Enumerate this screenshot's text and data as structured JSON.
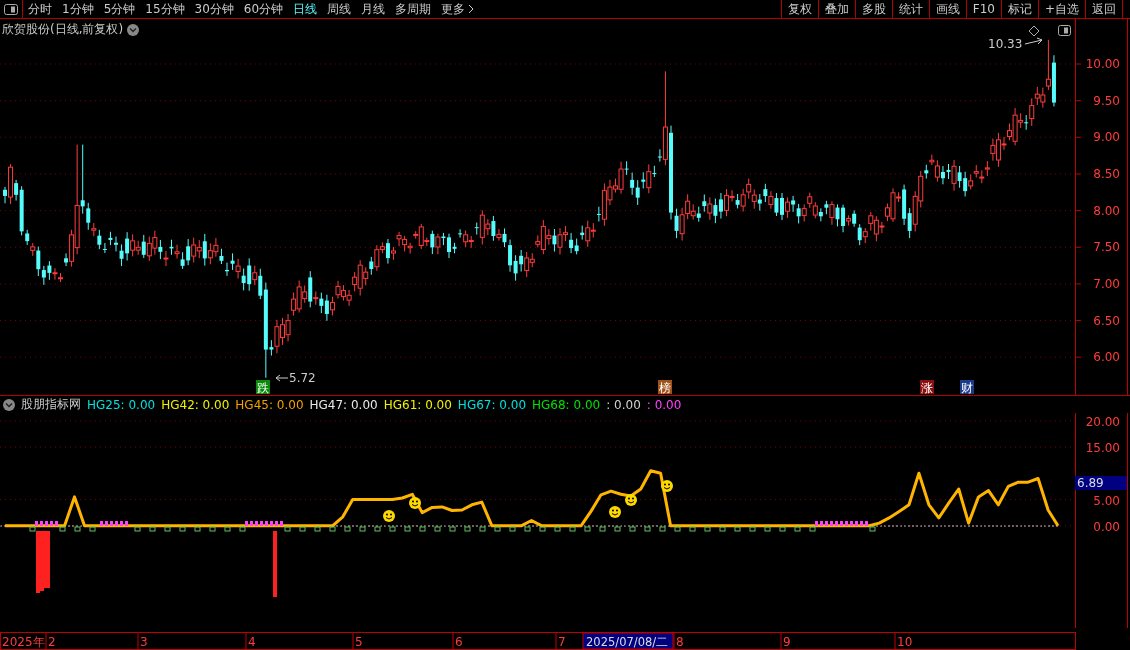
{
  "toolbar": {
    "periods": [
      {
        "label": "分时",
        "selected": false
      },
      {
        "label": "1分钟",
        "selected": false
      },
      {
        "label": "5分钟",
        "selected": false
      },
      {
        "label": "15分钟",
        "selected": false
      },
      {
        "label": "30分钟",
        "selected": false
      },
      {
        "label": "60分钟",
        "selected": false
      },
      {
        "label": "日线",
        "selected": true
      },
      {
        "label": "周线",
        "selected": false
      },
      {
        "label": "月线",
        "selected": false
      },
      {
        "label": "多周期",
        "selected": false
      },
      {
        "label": "更多",
        "selected": false
      }
    ],
    "buttons": [
      "复权",
      "叠加",
      "多股",
      "统计",
      "画线",
      "F10",
      "标记",
      "+自选",
      "返回"
    ]
  },
  "price_chart": {
    "title": "欣贺股份(日线,前复权)",
    "y_axis": [
      "10.00",
      "9.50",
      "9.00",
      "8.50",
      "8.00",
      "7.50",
      "7.00",
      "6.50",
      "6.00"
    ],
    "high_label": "10.33",
    "low_label": "5.72",
    "markers": [
      {
        "text": "跌",
        "color": "#0a8a0a"
      },
      {
        "text": "榜",
        "color": "#a0521a"
      },
      {
        "text": "涨",
        "color": "#8a1010"
      },
      {
        "text": "财",
        "color": "#1a3a8a"
      }
    ]
  },
  "indicator": {
    "name": "股朋指标网",
    "series": [
      {
        "label": "HG25: 0.00",
        "color": "#00e0e0"
      },
      {
        "label": "HG42: 0.00",
        "color": "#f0f000"
      },
      {
        "label": "HG45: 0.00",
        "color": "#f0a000"
      },
      {
        "label": "HG47: 0.00",
        "color": "#e8e8e8"
      },
      {
        "label": "HG61: 0.00",
        "color": "#f0f000"
      },
      {
        "label": "HG67: 0.00",
        "color": "#00e0e0"
      },
      {
        "label": "HG68: 0.00",
        "color": "#00e000"
      },
      {
        "label": ": 0.00",
        "color": "#d0d0d0"
      },
      {
        "label": ": 0.00",
        "color": "#ff40ff"
      }
    ],
    "current_value": "6.89",
    "chart_data": {
      "type": "line",
      "ylim": [
        -19.5,
        21.5
      ],
      "grid": true,
      "yticks": [
        {
          "value": 0,
          "label": "0.00"
        },
        {
          "value": 5,
          "label": "5.00"
        },
        {
          "value": 15,
          "label": "15.00"
        },
        {
          "value": 20,
          "label": "20.00"
        }
      ],
      "series": [
        {
          "color": "#ffb400",
          "values": [
            0,
            0,
            0,
            0,
            0,
            0,
            0,
            5.5,
            0,
            0,
            0,
            0,
            0,
            0,
            0,
            0,
            0,
            0,
            0,
            0,
            0,
            0,
            0,
            0,
            0,
            0,
            0,
            0,
            0,
            0,
            0,
            0,
            0,
            0,
            1.7,
            5,
            5,
            5,
            5,
            5,
            5.3,
            6,
            2.5,
            3.5,
            3.6,
            2.9,
            3,
            4,
            4.5,
            0,
            0,
            0,
            0,
            1,
            0,
            0,
            0,
            0,
            0,
            2.8,
            5.9,
            6.6,
            6,
            5.7,
            7,
            10.5,
            10,
            0,
            0,
            0,
            0,
            0,
            0,
            0,
            0,
            0,
            0,
            0,
            0,
            0,
            0,
            0,
            0,
            0,
            0,
            0,
            0,
            0,
            0.5,
            1.5,
            2.7,
            4,
            10,
            4,
            1.5,
            4.3,
            7,
            0.5,
            5.5,
            6.7,
            4,
            7.5,
            8.3,
            8.3,
            9,
            3,
            0
          ]
        }
      ]
    }
  },
  "time_axis": {
    "labels": [
      "2025年",
      "2",
      "3",
      "4",
      "5",
      "6",
      "7",
      "8",
      "9",
      "10"
    ],
    "cursor_date": "2025/07/08/二"
  }
}
